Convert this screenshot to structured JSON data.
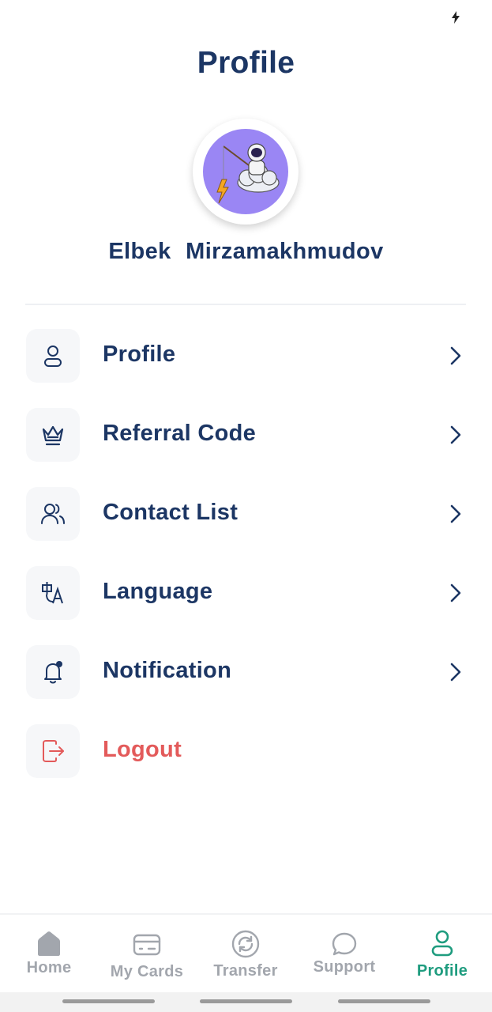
{
  "header": {
    "title": "Profile"
  },
  "user": {
    "name": "Elbek  Mirzamakhmudov"
  },
  "menu": {
    "items": [
      {
        "label": "Profile",
        "icon": "user-icon"
      },
      {
        "label": "Referral Code",
        "icon": "crown-icon"
      },
      {
        "label": "Contact List",
        "icon": "contacts-icon"
      },
      {
        "label": "Language",
        "icon": "translate-icon"
      },
      {
        "label": "Notification",
        "icon": "bell-icon"
      },
      {
        "label": "Logout",
        "icon": "logout-icon"
      }
    ]
  },
  "bottom_nav": {
    "items": [
      {
        "label": "Home",
        "icon": "home-icon"
      },
      {
        "label": "My Cards",
        "icon": "card-icon"
      },
      {
        "label": "Transfer",
        "icon": "transfer-icon"
      },
      {
        "label": "Support",
        "icon": "chat-icon"
      },
      {
        "label": "Profile",
        "icon": "user-icon",
        "active": true
      }
    ]
  },
  "colors": {
    "primary_text": "#1c3664",
    "danger": "#e35a5a",
    "active_nav": "#1f9c7f",
    "inactive_nav": "#a2a6ad",
    "avatar_bg": "#9a86f4"
  }
}
